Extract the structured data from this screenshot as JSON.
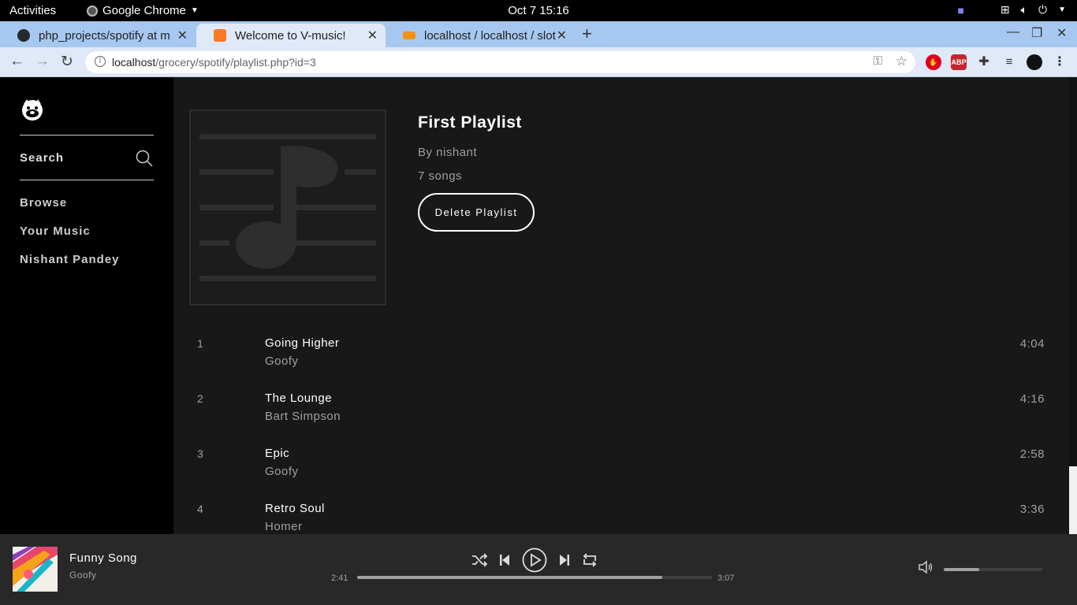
{
  "system_bar": {
    "activities": "Activities",
    "app_name": "Google Chrome",
    "clock": "Oct 7  15:16"
  },
  "browser": {
    "tabs": [
      {
        "title": "php_projects/spotify at m",
        "icon": "github-icon",
        "active": false
      },
      {
        "title": "Welcome to V-music!",
        "icon": "xampp-icon",
        "active": true
      },
      {
        "title": "localhost / localhost / slot",
        "icon": "phpmyadmin-icon",
        "active": false
      }
    ],
    "url_host": "localhost",
    "url_path": "/grocery/spotify/playlist.php?id=3"
  },
  "sidebar": {
    "search_label": "Search",
    "nav": [
      {
        "label": "Browse"
      },
      {
        "label": "Your Music"
      },
      {
        "label": "Nishant Pandey"
      }
    ]
  },
  "playlist": {
    "title": "First Playlist",
    "owner": "By nishant",
    "song_count": "7 songs",
    "delete_label": "Delete Playlist"
  },
  "tracks": [
    {
      "num": "1",
      "name": "Going Higher",
      "artist": "Goofy",
      "duration": "4:04"
    },
    {
      "num": "2",
      "name": "The Lounge",
      "artist": "Bart Simpson",
      "duration": "4:16"
    },
    {
      "num": "3",
      "name": "Epic",
      "artist": "Goofy",
      "duration": "2:58"
    },
    {
      "num": "4",
      "name": "Retro Soul",
      "artist": "Homer",
      "duration": "3:36"
    }
  ],
  "player": {
    "title": "Funny Song",
    "artist": "Goofy",
    "current_time": "2:41",
    "total_time": "3:07",
    "progress_fraction": 0.86,
    "volume_fraction": 0.36
  },
  "colors": {
    "sidebar_bg": "#000000",
    "main_bg": "#181818",
    "player_bg": "#282828",
    "text_primary": "#ffffff",
    "text_secondary": "#a0a0a0",
    "chrome_tabbar": "#a6c8f0"
  }
}
